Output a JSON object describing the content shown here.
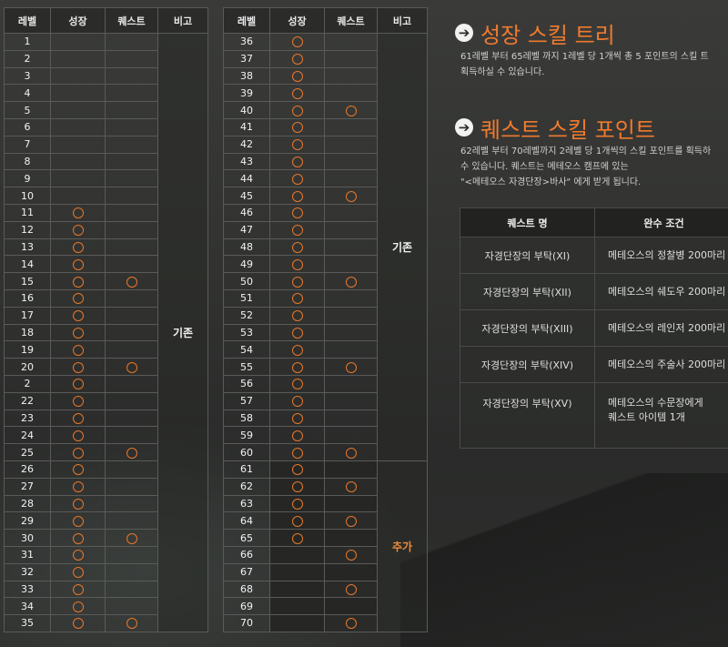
{
  "left_table": {
    "headers": [
      "레벨",
      "성장",
      "퀘스트",
      "비고"
    ],
    "note": "기존",
    "rows": [
      {
        "level": "1",
        "growth": false,
        "quest": false
      },
      {
        "level": "2",
        "growth": false,
        "quest": false
      },
      {
        "level": "3",
        "growth": false,
        "quest": false
      },
      {
        "level": "4",
        "growth": false,
        "quest": false
      },
      {
        "level": "5",
        "growth": false,
        "quest": false
      },
      {
        "level": "6",
        "growth": false,
        "quest": false
      },
      {
        "level": "7",
        "growth": false,
        "quest": false
      },
      {
        "level": "8",
        "growth": false,
        "quest": false
      },
      {
        "level": "9",
        "growth": false,
        "quest": false
      },
      {
        "level": "10",
        "growth": false,
        "quest": false
      },
      {
        "level": "11",
        "growth": true,
        "quest": false
      },
      {
        "level": "12",
        "growth": true,
        "quest": false
      },
      {
        "level": "13",
        "growth": true,
        "quest": false
      },
      {
        "level": "14",
        "growth": true,
        "quest": false
      },
      {
        "level": "15",
        "growth": true,
        "quest": true
      },
      {
        "level": "16",
        "growth": true,
        "quest": false
      },
      {
        "level": "17",
        "growth": true,
        "quest": false
      },
      {
        "level": "18",
        "growth": true,
        "quest": false
      },
      {
        "level": "19",
        "growth": true,
        "quest": false
      },
      {
        "level": "20",
        "growth": true,
        "quest": true
      },
      {
        "level": "2",
        "growth": true,
        "quest": false
      },
      {
        "level": "22",
        "growth": true,
        "quest": false
      },
      {
        "level": "23",
        "growth": true,
        "quest": false
      },
      {
        "level": "24",
        "growth": true,
        "quest": false
      },
      {
        "level": "25",
        "growth": true,
        "quest": true
      },
      {
        "level": "26",
        "growth": true,
        "quest": false
      },
      {
        "level": "27",
        "growth": true,
        "quest": false
      },
      {
        "level": "28",
        "growth": true,
        "quest": false
      },
      {
        "level": "29",
        "growth": true,
        "quest": false
      },
      {
        "level": "30",
        "growth": true,
        "quest": true
      },
      {
        "level": "31",
        "growth": true,
        "quest": false
      },
      {
        "level": "32",
        "growth": true,
        "quest": false
      },
      {
        "level": "33",
        "growth": true,
        "quest": false
      },
      {
        "level": "34",
        "growth": true,
        "quest": false
      },
      {
        "level": "35",
        "growth": true,
        "quest": true
      }
    ]
  },
  "right_table": {
    "headers": [
      "레벨",
      "성장",
      "퀘스트",
      "비고"
    ],
    "note_existing": "기존",
    "note_added": "추가",
    "existing_rows": 25,
    "rows": [
      {
        "level": "36",
        "growth": true,
        "quest": false
      },
      {
        "level": "37",
        "growth": true,
        "quest": false
      },
      {
        "level": "38",
        "growth": true,
        "quest": false
      },
      {
        "level": "39",
        "growth": true,
        "quest": false
      },
      {
        "level": "40",
        "growth": true,
        "quest": true
      },
      {
        "level": "41",
        "growth": true,
        "quest": false
      },
      {
        "level": "42",
        "growth": true,
        "quest": false
      },
      {
        "level": "43",
        "growth": true,
        "quest": false
      },
      {
        "level": "44",
        "growth": true,
        "quest": false
      },
      {
        "level": "45",
        "growth": true,
        "quest": true
      },
      {
        "level": "46",
        "growth": true,
        "quest": false
      },
      {
        "level": "47",
        "growth": true,
        "quest": false
      },
      {
        "level": "48",
        "growth": true,
        "quest": false
      },
      {
        "level": "49",
        "growth": true,
        "quest": false
      },
      {
        "level": "50",
        "growth": true,
        "quest": true
      },
      {
        "level": "51",
        "growth": true,
        "quest": false
      },
      {
        "level": "52",
        "growth": true,
        "quest": false
      },
      {
        "level": "53",
        "growth": true,
        "quest": false
      },
      {
        "level": "54",
        "growth": true,
        "quest": false
      },
      {
        "level": "55",
        "growth": true,
        "quest": true
      },
      {
        "level": "56",
        "growth": true,
        "quest": false
      },
      {
        "level": "57",
        "growth": true,
        "quest": false
      },
      {
        "level": "58",
        "growth": true,
        "quest": false
      },
      {
        "level": "59",
        "growth": true,
        "quest": false
      },
      {
        "level": "60",
        "growth": true,
        "quest": true
      },
      {
        "level": "61",
        "growth": true,
        "quest": false
      },
      {
        "level": "62",
        "growth": true,
        "quest": true
      },
      {
        "level": "63",
        "growth": true,
        "quest": false
      },
      {
        "level": "64",
        "growth": true,
        "quest": true
      },
      {
        "level": "65",
        "growth": true,
        "quest": false
      },
      {
        "level": "66",
        "growth": false,
        "quest": true
      },
      {
        "level": "67",
        "growth": false,
        "quest": false
      },
      {
        "level": "68",
        "growth": false,
        "quest": true
      },
      {
        "level": "69",
        "growth": false,
        "quest": false
      },
      {
        "level": "70",
        "growth": false,
        "quest": true
      }
    ]
  },
  "growth_section": {
    "title": "성장 스킬 트리",
    "lines": [
      "61레벨 부터 65레벨 까지 1레벨 당 1개씩 총 5 포인트의 스킬 트",
      "획득하실 수 있습니다."
    ]
  },
  "quest_section": {
    "title": "퀘스트 스킬 포인트",
    "lines": [
      "62레벨 부터 70레벨까지 2레벨 당 1개씩의 스킬 포인트를 획득하",
      "수 있습니다. 퀘스트는 메테오스 캠프에 있는",
      "\"<메테오스 자경단장>바사\" 에게 받게 됩니다."
    ]
  },
  "quest_table": {
    "headers": [
      "퀘스트 명",
      "완수 조건"
    ],
    "rows": [
      {
        "name": "자경단장의 부탁(XI)",
        "condition": "메테오스의 정찰병 200마리"
      },
      {
        "name": "자경단장의 부탁(XII)",
        "condition": "메테오스의 쉐도우 200마리"
      },
      {
        "name": "자경단장의 부탁(XIII)",
        "condition": "메테오스의 레인저 200마리"
      },
      {
        "name": "자경단장의 부탁(XIV)",
        "condition": "메테오스의 주술사 200마리"
      },
      {
        "name": "자경단장의 부탁(XV)",
        "condition": "메테오스의 수문장에게|퀘스트 아이템 1개"
      }
    ]
  },
  "colors": {
    "accent": "#f07a2e",
    "circle": "#e8772a"
  },
  "icons": {
    "section_marker": "arrow-circle-icon",
    "mark": "circle-mark-icon"
  }
}
